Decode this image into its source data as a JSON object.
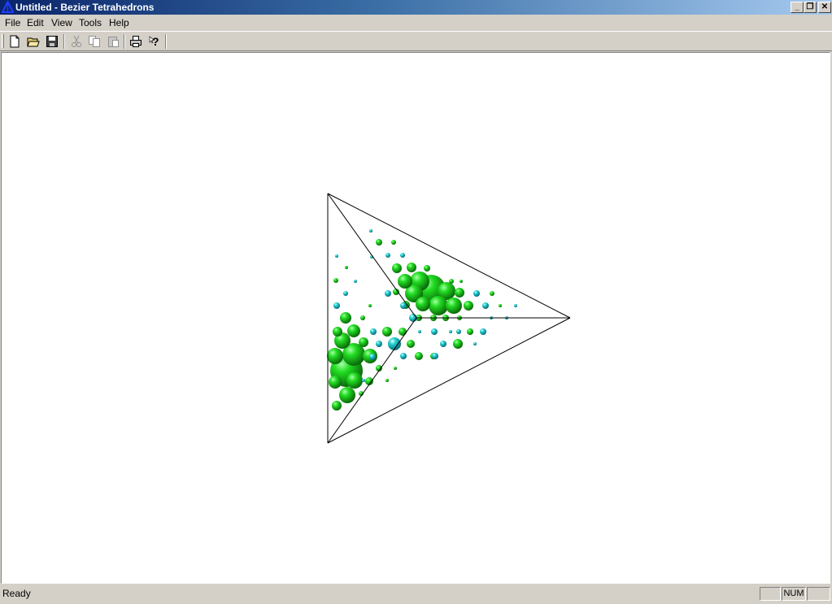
{
  "window": {
    "title": "Untitled - Bezier Tetrahedrons"
  },
  "window_controls": {
    "minimize": "_",
    "restore": "❐",
    "close": "✕"
  },
  "menu": {
    "file": "File",
    "edit": "Edit",
    "view": "View",
    "tools": "Tools",
    "help": "Help"
  },
  "toolbar": {
    "icons": [
      "new-document-icon",
      "open-folder-icon",
      "save-disk-icon",
      "cut-scissors-icon",
      "copy-icon",
      "paste-icon",
      "print-icon",
      "help-question-icon"
    ],
    "disabled": [
      "cut-scissors-icon",
      "copy-icon",
      "paste-icon"
    ]
  },
  "colors": {
    "sphere_green": "#22cc22",
    "sphere_cyan": "#22cccc",
    "edge": "#000000"
  },
  "status": {
    "text": "Ready",
    "num_indicator": "NUM"
  }
}
